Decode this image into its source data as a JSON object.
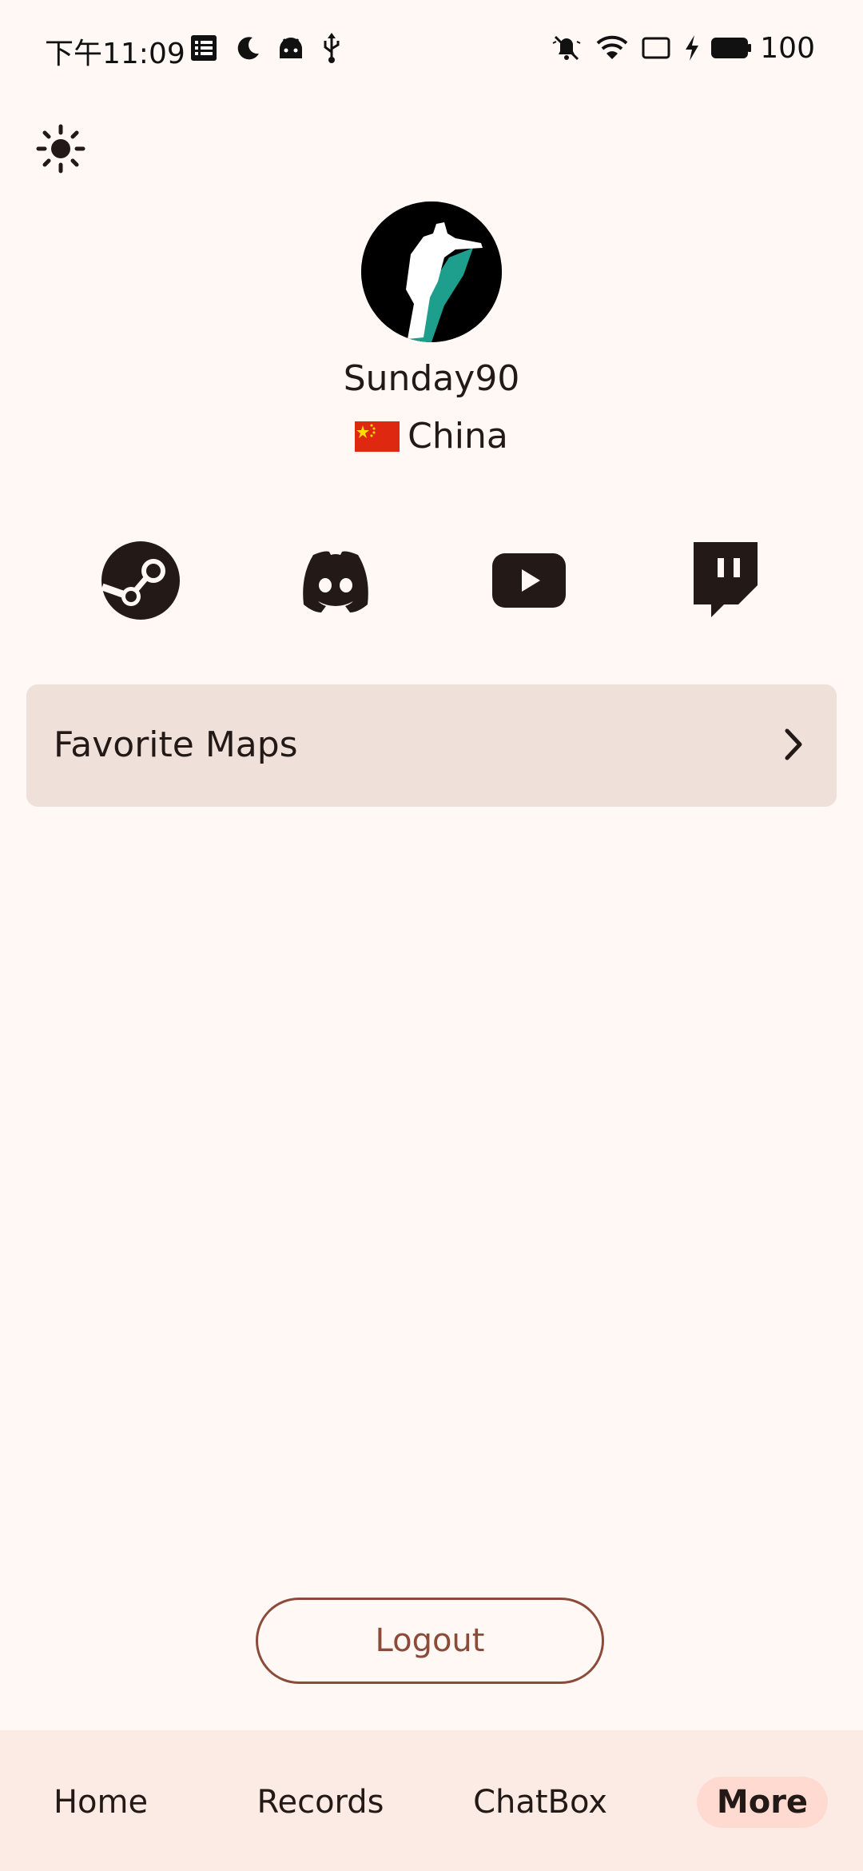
{
  "status_bar": {
    "time": "下午11:09",
    "battery": "100",
    "icons_left": [
      "notes-icon",
      "moon-icon",
      "android-icon",
      "usb-icon"
    ],
    "icons_right": [
      "mute-icon",
      "wifi-icon",
      "cast-icon",
      "charging-icon",
      "battery-icon"
    ]
  },
  "theme_toggle": {
    "icon": "sun-icon"
  },
  "profile": {
    "username": "Sunday90",
    "country": "China",
    "avatar": "avatar-image",
    "flag": "china-flag-icon"
  },
  "socials": [
    "steam-icon",
    "discord-icon",
    "youtube-icon",
    "twitch-icon"
  ],
  "favorite_maps": {
    "label": "Favorite Maps"
  },
  "logout": {
    "label": "Logout"
  },
  "bottom_nav": {
    "items": [
      {
        "label": "Home"
      },
      {
        "label": "Records"
      },
      {
        "label": "ChatBox"
      },
      {
        "label": "More",
        "active": true
      }
    ]
  },
  "colors": {
    "background": "#FFF8F5",
    "card": "#F0E0DA",
    "accent": "#8C4A38",
    "nav_bg": "#FCEAE4",
    "nav_active": "#FFDAD1"
  }
}
